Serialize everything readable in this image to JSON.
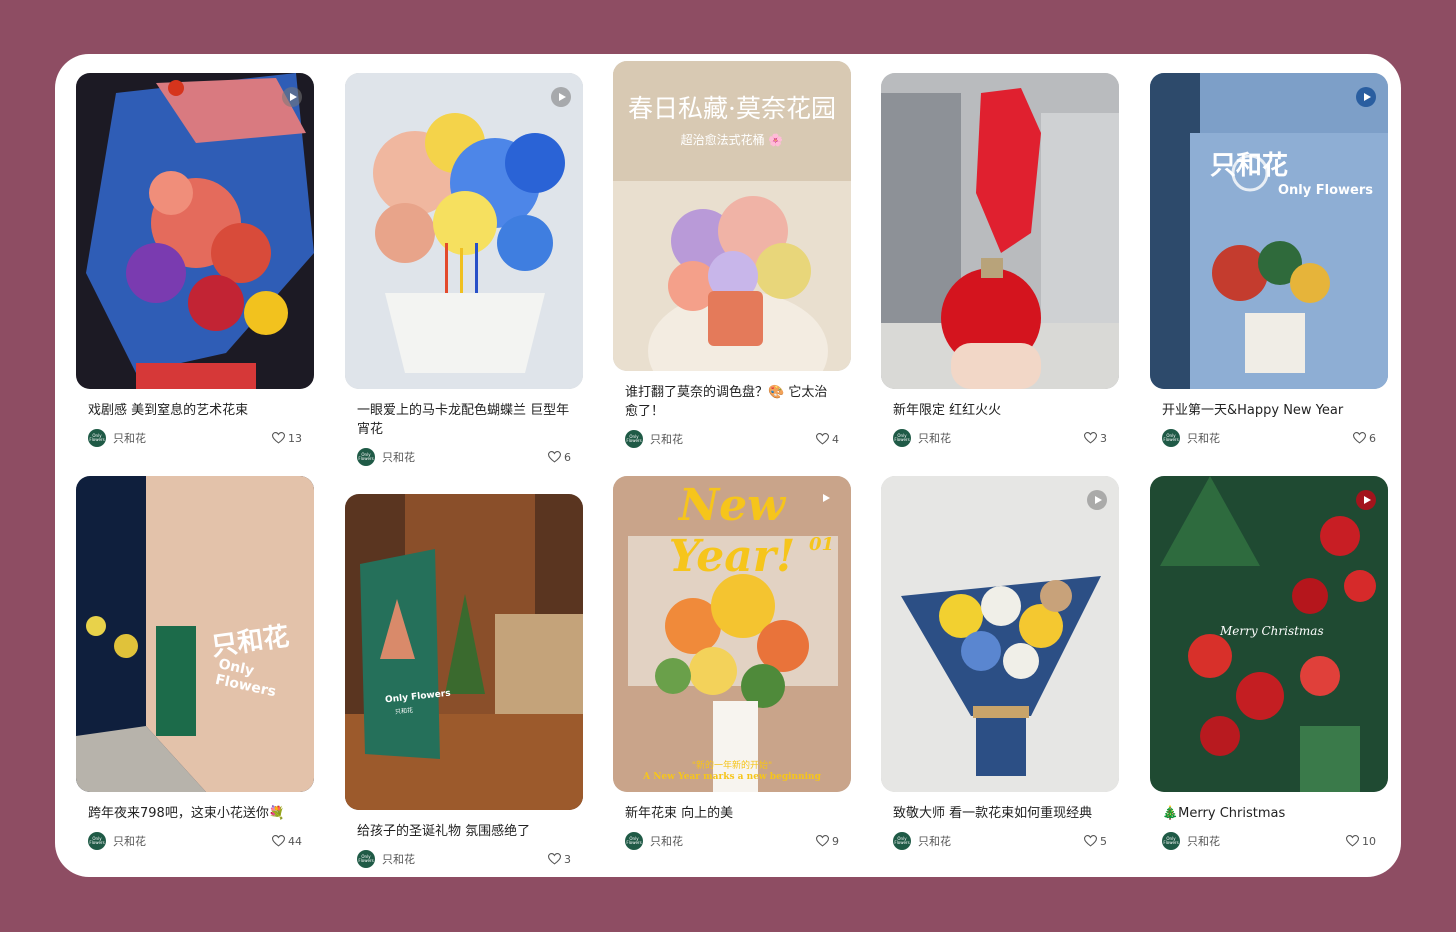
{
  "author": {
    "name": "只和花",
    "avatar_text": "Only Flowers"
  },
  "posts": [
    {
      "title": "戏剧感 美到窒息的艺术花束",
      "likes": "13",
      "overlay": ""
    },
    {
      "title": "一眼爱上的马卡龙配色蝴蝶兰 巨型年宵花",
      "likes": "6",
      "overlay": ""
    },
    {
      "title": "谁打翻了莫奈的调色盘？🎨 它太治愈了！",
      "likes": "4",
      "overlay": "春日私藏·莫奈花园",
      "overlay_sub": "超治愈法式花桶 🌸"
    },
    {
      "title": "新年限定 红红火火",
      "likes": "3",
      "overlay": ""
    },
    {
      "title": "开业第一天&Happy New Year",
      "likes": "6",
      "overlay": "只和花",
      "overlay_sub": "Only Flowers"
    },
    {
      "title": "跨年夜来798吧，这束小花送你💐",
      "likes": "44",
      "overlay": "只和花",
      "overlay_sub": "Only Flowers"
    },
    {
      "title": "给孩子的圣诞礼物 氛围感绝了",
      "likes": "3",
      "overlay": "Only Flowers",
      "overlay_sub": "只和花"
    },
    {
      "title": "新年花束 向上的美",
      "likes": "9",
      "overlay": "New Year!",
      "overlay_sub": "01",
      "overlay_bottom": "\"新的一年新的开始\"",
      "overlay_bottom2": "A New Year marks a new beginning"
    },
    {
      "title": "致敬大师 看一款花束如何重现经典",
      "likes": "5",
      "overlay": ""
    },
    {
      "title": "🎄Merry Christmas",
      "likes": "10",
      "overlay": "Merry Christmas"
    }
  ]
}
